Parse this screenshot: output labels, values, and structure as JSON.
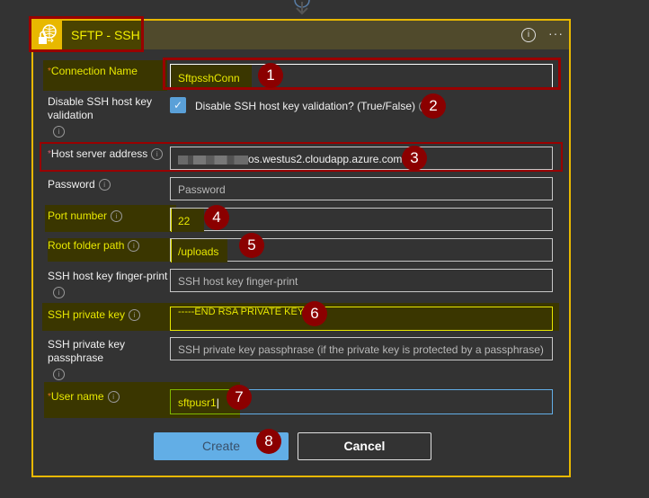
{
  "card": {
    "title": "SFTP - SSH",
    "header_icon": "sftp-globe-lock-icon",
    "info_icon": "i",
    "more_icon": "···"
  },
  "form": {
    "connection_name": {
      "label": "Connection Name",
      "required": "*",
      "value": "SftpsshConn",
      "badge": "1"
    },
    "disable_validation": {
      "label": "Disable SSH host key validation",
      "checkbox_label": "Disable SSH host key validation? (True/False)",
      "checked": true,
      "badge": "2"
    },
    "host_server": {
      "label": "Host server address",
      "required": "*",
      "value_visible": "os.westus2.cloudapp.azure.com",
      "badge": "3"
    },
    "password": {
      "label": "Password",
      "placeholder": "Password"
    },
    "port": {
      "label": "Port number",
      "value": "22",
      "badge": "4"
    },
    "root_folder": {
      "label": "Root folder path",
      "value": "/uploads",
      "badge": "5"
    },
    "fingerprint": {
      "label": "SSH host key finger-print",
      "placeholder": "SSH host key finger-print"
    },
    "private_key": {
      "label": "SSH private key",
      "value": "-----END RSA PRIVATE KEY",
      "badge": "6"
    },
    "passphrase": {
      "label": "SSH private key passphrase",
      "placeholder": "SSH private key passphrase (if the private key is protected by a passphrase)"
    },
    "user_name": {
      "label": "User name",
      "required": "*",
      "value": "sftpusr1",
      "badge": "7"
    }
  },
  "actions": {
    "create_label": "Create",
    "cancel_label": "Cancel",
    "badge": "8"
  },
  "colors": {
    "accent": "#e8b800",
    "highlight_text": "#e8e800",
    "annotation": "#990000",
    "create_bg": "#62aee6"
  }
}
